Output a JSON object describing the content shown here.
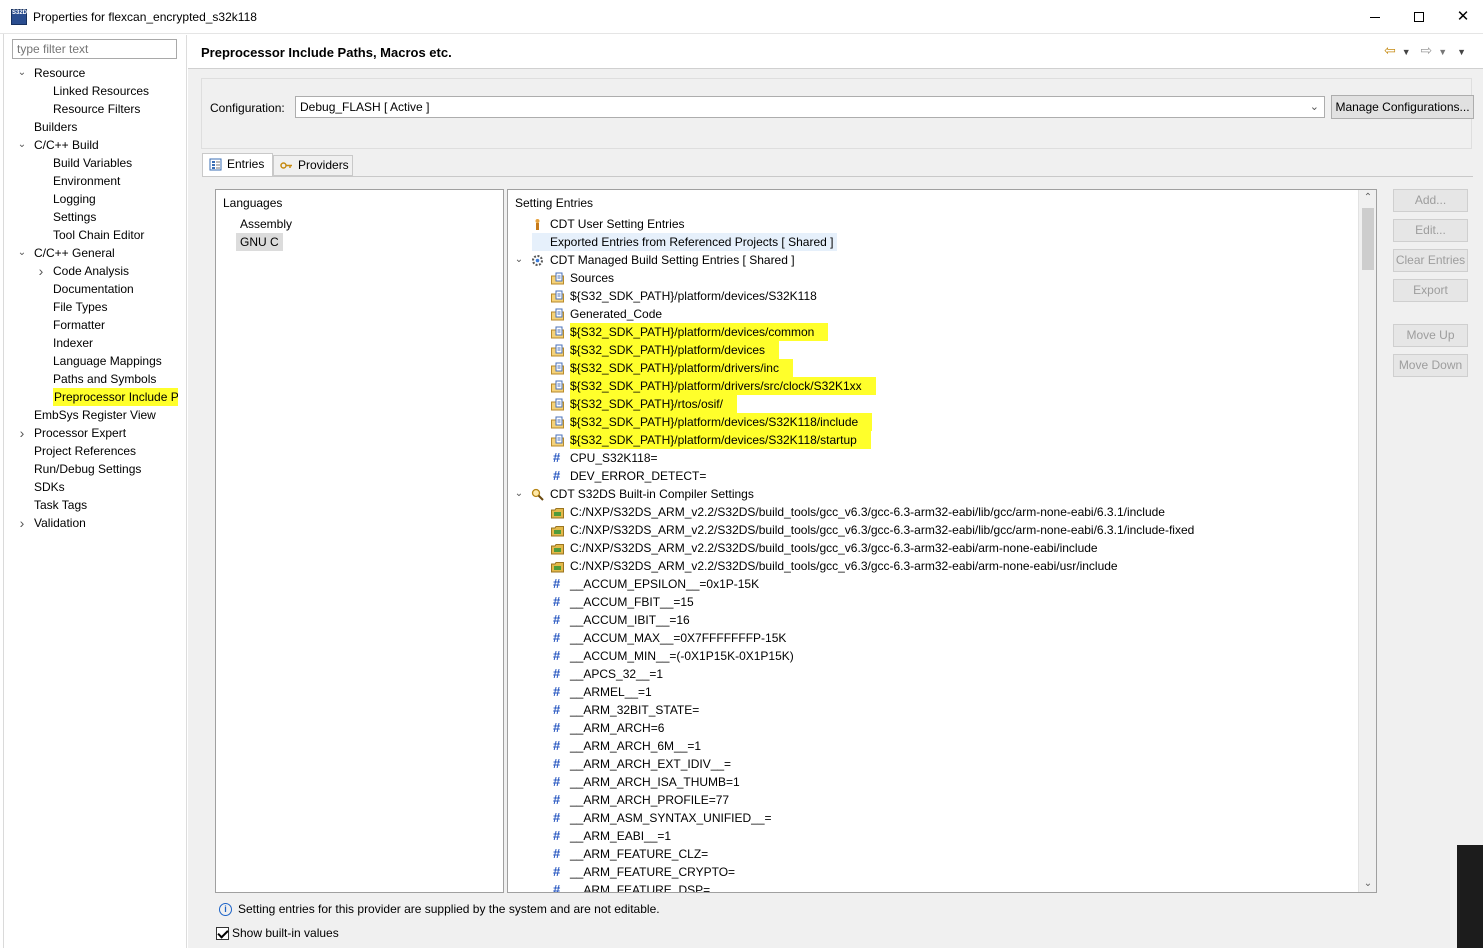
{
  "window": {
    "title": "Properties for flexcan_encrypted_s32k118",
    "app_icon_text": "S32DS"
  },
  "left": {
    "filter_placeholder": "type filter text",
    "tree": [
      {
        "label": "Resource",
        "expanded": true,
        "level": 0
      },
      {
        "label": "Linked Resources",
        "level": 1
      },
      {
        "label": "Resource Filters",
        "level": 1
      },
      {
        "label": "Builders",
        "level": 0
      },
      {
        "label": "C/C++ Build",
        "expanded": true,
        "level": 0
      },
      {
        "label": "Build Variables",
        "level": 1
      },
      {
        "label": "Environment",
        "level": 1
      },
      {
        "label": "Logging",
        "level": 1
      },
      {
        "label": "Settings",
        "level": 1
      },
      {
        "label": "Tool Chain Editor",
        "level": 1
      },
      {
        "label": "C/C++ General",
        "expanded": true,
        "level": 0
      },
      {
        "label": "Code Analysis",
        "collapsed": true,
        "level": 1
      },
      {
        "label": "Documentation",
        "level": 1
      },
      {
        "label": "File Types",
        "level": 1
      },
      {
        "label": "Formatter",
        "level": 1
      },
      {
        "label": "Indexer",
        "level": 1
      },
      {
        "label": "Language Mappings",
        "level": 1
      },
      {
        "label": "Paths and Symbols",
        "level": 1
      },
      {
        "label": "Preprocessor Include Pa",
        "level": 1,
        "selected": true
      },
      {
        "label": "EmbSys Register View",
        "level": 0
      },
      {
        "label": "Processor Expert",
        "collapsed": true,
        "level": 0
      },
      {
        "label": "Project References",
        "level": 0
      },
      {
        "label": "Run/Debug Settings",
        "level": 0
      },
      {
        "label": "SDKs",
        "level": 0
      },
      {
        "label": "Task Tags",
        "level": 0
      },
      {
        "label": "Validation",
        "collapsed": true,
        "level": 0
      }
    ]
  },
  "main": {
    "title": "Preprocessor Include Paths, Macros etc.",
    "config_label": "Configuration:",
    "config_value": "Debug_FLASH  [ Active ]",
    "manage_button": "Manage Configurations...",
    "tabs": [
      "Entries",
      "Providers"
    ],
    "languages_header": "Languages",
    "languages": [
      "Assembly",
      "GNU C"
    ],
    "entries_header": "Setting Entries",
    "entries": [
      {
        "text": "CDT User Setting Entries",
        "level": 0,
        "icon": "user"
      },
      {
        "text": "Exported Entries from Referenced Projects   [ Shared ]",
        "level": 0,
        "icon": "page",
        "selected": true
      },
      {
        "text": "CDT Managed Build Setting Entries   [ Shared ]",
        "level": 0,
        "icon": "gear",
        "expanded": true
      },
      {
        "text": "Sources",
        "level": 1,
        "icon": "folder-doc"
      },
      {
        "text": "${S32_SDK_PATH}/platform/devices/S32K118",
        "level": 1,
        "icon": "folder-doc"
      },
      {
        "text": "Generated_Code",
        "level": 1,
        "icon": "folder-doc"
      },
      {
        "text": "${S32_SDK_PATH}/platform/devices/common",
        "level": 1,
        "icon": "folder-doc",
        "hl": true
      },
      {
        "text": "${S32_SDK_PATH}/platform/devices",
        "level": 1,
        "icon": "folder-doc",
        "hl": true
      },
      {
        "text": "${S32_SDK_PATH}/platform/drivers/inc",
        "level": 1,
        "icon": "folder-doc",
        "hl": true
      },
      {
        "text": "${S32_SDK_PATH}/platform/drivers/src/clock/S32K1xx",
        "level": 1,
        "icon": "folder-doc",
        "hl": true
      },
      {
        "text": "${S32_SDK_PATH}/rtos/osif/",
        "level": 1,
        "icon": "folder-doc",
        "hl": true
      },
      {
        "text": "${S32_SDK_PATH}/platform/devices/S32K118/include",
        "level": 1,
        "icon": "folder-doc",
        "hl": true
      },
      {
        "text": "${S32_SDK_PATH}/platform/devices/S32K118/startup",
        "level": 1,
        "icon": "folder-doc",
        "hl": true
      },
      {
        "text": "CPU_S32K118=",
        "level": 1,
        "icon": "hash"
      },
      {
        "text": "DEV_ERROR_DETECT=",
        "level": 1,
        "icon": "hash"
      },
      {
        "text": "CDT S32DS Built-in Compiler Settings",
        "level": 0,
        "icon": "magnifier",
        "expanded": true
      },
      {
        "text": "C:/NXP/S32DS_ARM_v2.2/S32DS/build_tools/gcc_v6.3/gcc-6.3-arm32-eabi/lib/gcc/arm-none-eabi/6.3.1/include",
        "level": 1,
        "icon": "folder-lib"
      },
      {
        "text": "C:/NXP/S32DS_ARM_v2.2/S32DS/build_tools/gcc_v6.3/gcc-6.3-arm32-eabi/lib/gcc/arm-none-eabi/6.3.1/include-fixed",
        "level": 1,
        "icon": "folder-lib"
      },
      {
        "text": "C:/NXP/S32DS_ARM_v2.2/S32DS/build_tools/gcc_v6.3/gcc-6.3-arm32-eabi/arm-none-eabi/include",
        "level": 1,
        "icon": "folder-lib"
      },
      {
        "text": "C:/NXP/S32DS_ARM_v2.2/S32DS/build_tools/gcc_v6.3/gcc-6.3-arm32-eabi/arm-none-eabi/usr/include",
        "level": 1,
        "icon": "folder-lib"
      },
      {
        "text": "__ACCUM_EPSILON__=0x1P-15K",
        "level": 1,
        "icon": "hash"
      },
      {
        "text": "__ACCUM_FBIT__=15",
        "level": 1,
        "icon": "hash"
      },
      {
        "text": "__ACCUM_IBIT__=16",
        "level": 1,
        "icon": "hash"
      },
      {
        "text": "__ACCUM_MAX__=0X7FFFFFFFP-15K",
        "level": 1,
        "icon": "hash"
      },
      {
        "text": "__ACCUM_MIN__=(-0X1P15K-0X1P15K)",
        "level": 1,
        "icon": "hash"
      },
      {
        "text": "__APCS_32__=1",
        "level": 1,
        "icon": "hash"
      },
      {
        "text": "__ARMEL__=1",
        "level": 1,
        "icon": "hash"
      },
      {
        "text": "__ARM_32BIT_STATE=",
        "level": 1,
        "icon": "hash"
      },
      {
        "text": "__ARM_ARCH=6",
        "level": 1,
        "icon": "hash"
      },
      {
        "text": "__ARM_ARCH_6M__=1",
        "level": 1,
        "icon": "hash"
      },
      {
        "text": "__ARM_ARCH_EXT_IDIV__=",
        "level": 1,
        "icon": "hash"
      },
      {
        "text": "__ARM_ARCH_ISA_THUMB=1",
        "level": 1,
        "icon": "hash"
      },
      {
        "text": "__ARM_ARCH_PROFILE=77",
        "level": 1,
        "icon": "hash"
      },
      {
        "text": "__ARM_ASM_SYNTAX_UNIFIED__=",
        "level": 1,
        "icon": "hash"
      },
      {
        "text": "__ARM_EABI__=1",
        "level": 1,
        "icon": "hash"
      },
      {
        "text": "__ARM_FEATURE_CLZ=",
        "level": 1,
        "icon": "hash"
      },
      {
        "text": "__ARM_FEATURE_CRYPTO=",
        "level": 1,
        "icon": "hash"
      },
      {
        "text": "__ARM_FEATURE_DSP=",
        "level": 1,
        "icon": "hash"
      }
    ],
    "side_buttons": [
      "Add...",
      "Edit...",
      "Clear Entries",
      "Export",
      "Move Up",
      "Move Down"
    ],
    "info_text": "Setting entries for this provider are supplied by the system and are not editable.",
    "show_builtin_label": "Show built-in values",
    "show_builtin_checked": true
  },
  "colors": {
    "highlight": "#ffff2b",
    "hash": "#2a59c2",
    "nav_arrow": "#c58a12"
  }
}
